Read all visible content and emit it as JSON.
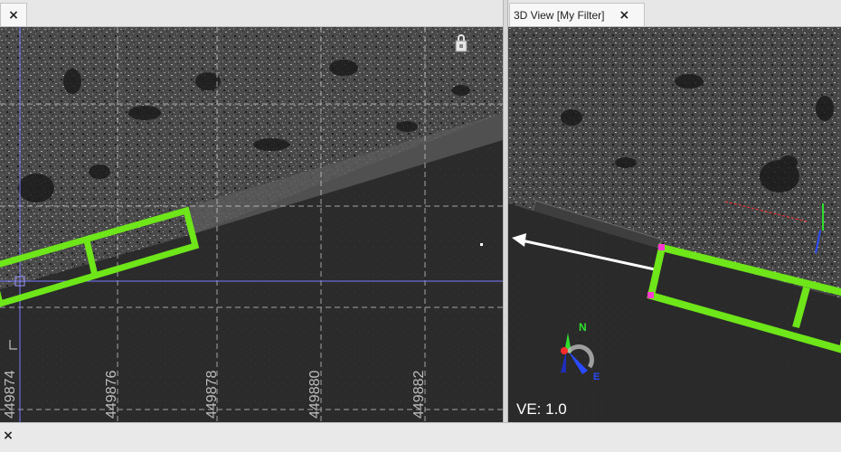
{
  "left_tab": {
    "close_glyph": "×"
  },
  "right_tab": {
    "title": "3D View [My Filter]",
    "close_glyph": "×"
  },
  "bottom_panel": {
    "close_glyph": "×"
  },
  "plan_view": {
    "grid_labels": [
      "449874",
      "449876",
      "449878",
      "449880",
      "449882"
    ]
  },
  "view_3d": {
    "ve_label": "VE: 1.0",
    "north_label": "N",
    "east_label": "E"
  },
  "colors": {
    "selection_box": "#6ee619",
    "crosshair": "#7878ff",
    "grid": "#d9d9d9",
    "handle": "#ff3ad0",
    "axis_x": "#ff2a2a",
    "axis_y": "#2ee02e",
    "axis_z": "#2a4bff"
  },
  "icons": [
    "close-icon",
    "lock-icon",
    "north-arrow-icon",
    "axis-triad-icon",
    "direction-arrow-icon"
  ]
}
